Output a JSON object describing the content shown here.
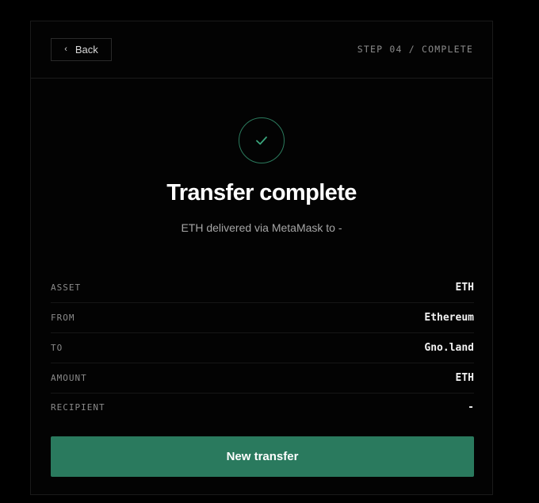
{
  "header": {
    "back_label": "Back",
    "step_label": "STEP 04 / COMPLETE"
  },
  "status": {
    "icon": "check-icon",
    "title": "Transfer complete",
    "subtitle": "ETH delivered via MetaMask to -"
  },
  "details": [
    {
      "label": "ASSET",
      "value": "ETH"
    },
    {
      "label": "FROM",
      "value": "Ethereum"
    },
    {
      "label": "TO",
      "value": "Gno.land"
    },
    {
      "label": "AMOUNT",
      "value": "ETH"
    },
    {
      "label": "RECIPIENT",
      "value": "-"
    }
  ],
  "actions": {
    "primary_label": "New transfer"
  },
  "colors": {
    "background": "#000000",
    "accent": "#2a7a5e",
    "success_ring": "#2b7a5d",
    "check": "#3aa57c",
    "muted_text": "#8a8a8a"
  }
}
